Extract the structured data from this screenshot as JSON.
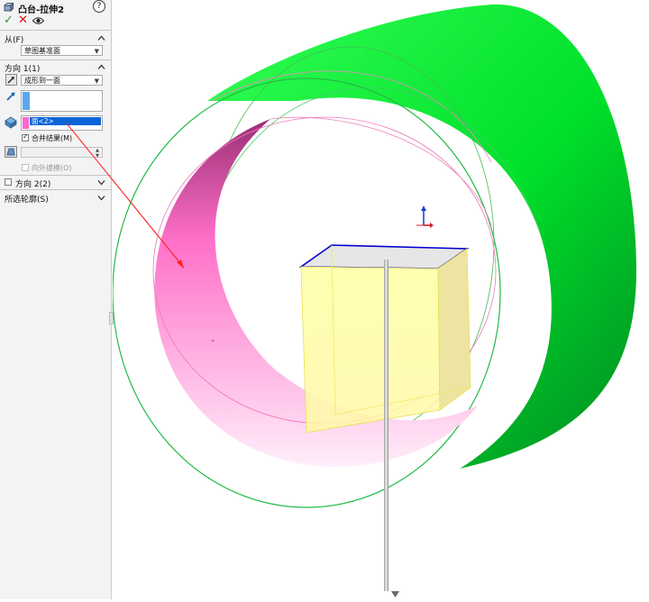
{
  "panel": {
    "title": "凸台-拉伸2",
    "help_icon": "?",
    "from_section": {
      "label": "从(F)",
      "combo_value": "草图基准面"
    },
    "direction1_section": {
      "label": "方向 1(1)",
      "end_condition": "成形到一面",
      "face_selection": "面<2>",
      "merge_label": "合并结果(M)",
      "merge_checked": true,
      "draft_outward_label": "向外拔模(O)",
      "draft_outward_enabled": false
    },
    "direction2_section": {
      "label": "方向 2(2)",
      "checked": false
    },
    "contours_section": {
      "label": "所选轮廓(S)"
    }
  },
  "colors": {
    "cylinder_outer": "#00dd33",
    "cylinder_inner_edge": "#22bb44",
    "face_selected": "#ff77cc",
    "preview_box": "#ffff99",
    "box_edge": "#0000cc",
    "leader_arrow": "#ff2222",
    "selection_blue": "#0a64d8"
  }
}
